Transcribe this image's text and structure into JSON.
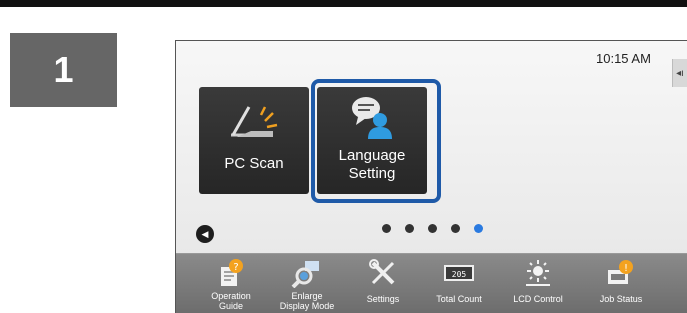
{
  "step": {
    "number": "1"
  },
  "status": {
    "time": "10:15 AM",
    "side_icon": "◂ı"
  },
  "tiles": [
    {
      "label": "PC Scan",
      "icon": "scanner-icon"
    },
    {
      "label": "Language\nSetting",
      "icon": "language-person-icon"
    }
  ],
  "pager": {
    "count": 5,
    "active_index": 4
  },
  "bottombar": {
    "items": [
      {
        "label": "Operation\nGuide",
        "icon": "operation-guide-icon"
      },
      {
        "label": "Enlarge\nDisplay Mode",
        "icon": "magnifier-icon"
      },
      {
        "label": "Settings",
        "icon": "wrench-screwdriver-icon"
      },
      {
        "label": "Total Count",
        "icon": "counter-icon"
      },
      {
        "label": "LCD Control",
        "icon": "brightness-icon"
      },
      {
        "label": "Job Status",
        "icon": "job-status-icon"
      }
    ]
  },
  "colors": {
    "highlight": "#1f5aa8",
    "active_dot": "#2a7ae0",
    "tile_bg": "#2e2e2e"
  }
}
